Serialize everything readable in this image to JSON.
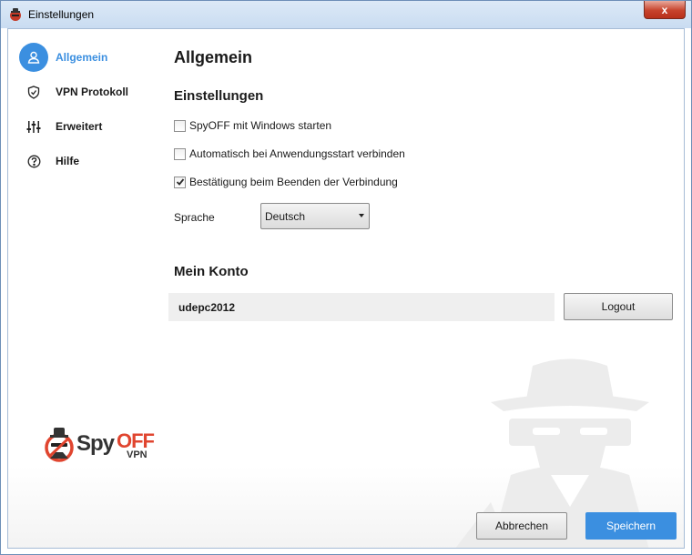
{
  "window": {
    "title": "Einstellungen",
    "close_label": "x"
  },
  "sidebar": {
    "items": [
      {
        "label": "Allgemein",
        "icon": "user-icon",
        "active": true
      },
      {
        "label": "VPN Protokoll",
        "icon": "shield-icon",
        "active": false
      },
      {
        "label": "Erweitert",
        "icon": "sliders-icon",
        "active": false
      },
      {
        "label": "Hilfe",
        "icon": "help-icon",
        "active": false
      }
    ]
  },
  "main": {
    "title": "Allgemein",
    "settings_heading": "Einstellungen",
    "options": [
      {
        "label": "SpyOFF mit Windows starten",
        "checked": false
      },
      {
        "label": "Automatisch bei Anwendungsstart verbinden",
        "checked": false
      },
      {
        "label": "Bestätigung beim Beenden der Verbindung",
        "checked": true
      }
    ],
    "language_label": "Sprache",
    "language_value": "Deutsch"
  },
  "account": {
    "heading": "Mein Konto",
    "username": "udepc2012",
    "logout_label": "Logout"
  },
  "logo": {
    "spy": "Spy",
    "off": "OFF",
    "vpn": "VPN"
  },
  "footer": {
    "cancel_label": "Abbrechen",
    "save_label": "Speichern"
  },
  "colors": {
    "accent": "#3b8fe0",
    "logo_red": "#e0452f"
  }
}
